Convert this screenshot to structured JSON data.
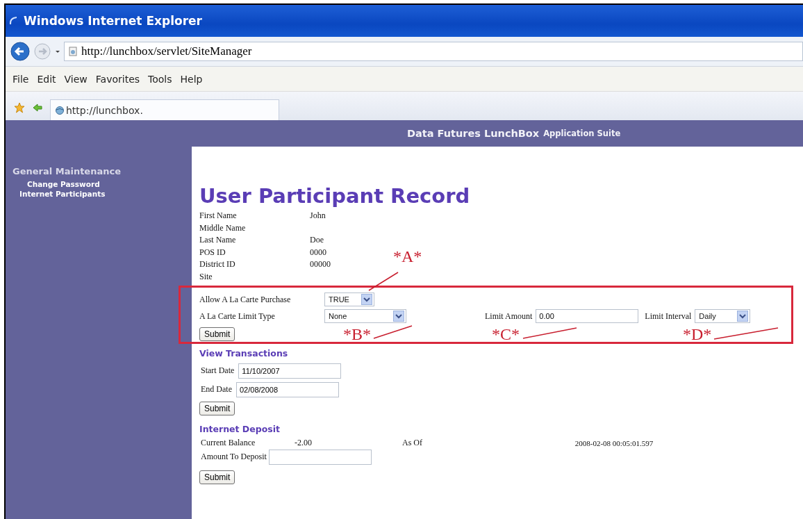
{
  "window": {
    "title": "Windows Internet Explorer"
  },
  "address_bar": {
    "url": "http://lunchbox/servlet/SiteManager"
  },
  "menu": [
    "File",
    "Edit",
    "View",
    "Favorites",
    "Tools",
    "Help"
  ],
  "tabs": [
    {
      "label": "http://lunchbox.",
      "selected": true
    }
  ],
  "app_header": {
    "brand": "Data Futures LunchBox",
    "suffix": "Application Suite"
  },
  "sidebar": {
    "heading": "General Maintenance",
    "items": [
      {
        "label": "Change Password"
      },
      {
        "label": "Internet Participants"
      }
    ]
  },
  "page": {
    "title": "User Participant Record",
    "fields": [
      {
        "label": "First Name",
        "value": "John"
      },
      {
        "label": "Middle Name"
      },
      {
        "label": "Last Name",
        "value": "Doe"
      },
      {
        "label": "POS ID",
        "value": "0000"
      },
      {
        "label": "District ID",
        "value": "00000"
      },
      {
        "label": "Site"
      }
    ],
    "limits": {
      "controls": [
        {
          "kind": "select",
          "label": "Allow A La Carte Purchase",
          "value": "TRUE"
        },
        {
          "kind": "select",
          "label": "A La Carte Limit Type",
          "value": "None"
        },
        {
          "kind": "input",
          "label": "Limit Amount",
          "value": "0.00"
        },
        {
          "kind": "select",
          "label": "Limit Interval",
          "value": "Daily"
        }
      ],
      "submit": "Submit"
    },
    "transactions": {
      "heading": "View Transactions",
      "fields": [
        {
          "label": "Start Date",
          "value": "11/10/2007"
        },
        {
          "label": "End Date",
          "value": "02/08/2008"
        }
      ],
      "submit": "Submit"
    },
    "deposit": {
      "heading": "Internet Deposit",
      "balance_label": "Current Balance",
      "balance": "-2.00",
      "as_of_label": "As Of",
      "as_of": "2008-02-08 00:05:01.597",
      "amount_label": "Amount To Deposit",
      "submit": "Submit"
    }
  },
  "annotations": [
    {
      "label": "*A*"
    },
    {
      "label": "*B*"
    },
    {
      "label": "*C*"
    },
    {
      "label": "*D*"
    }
  ]
}
